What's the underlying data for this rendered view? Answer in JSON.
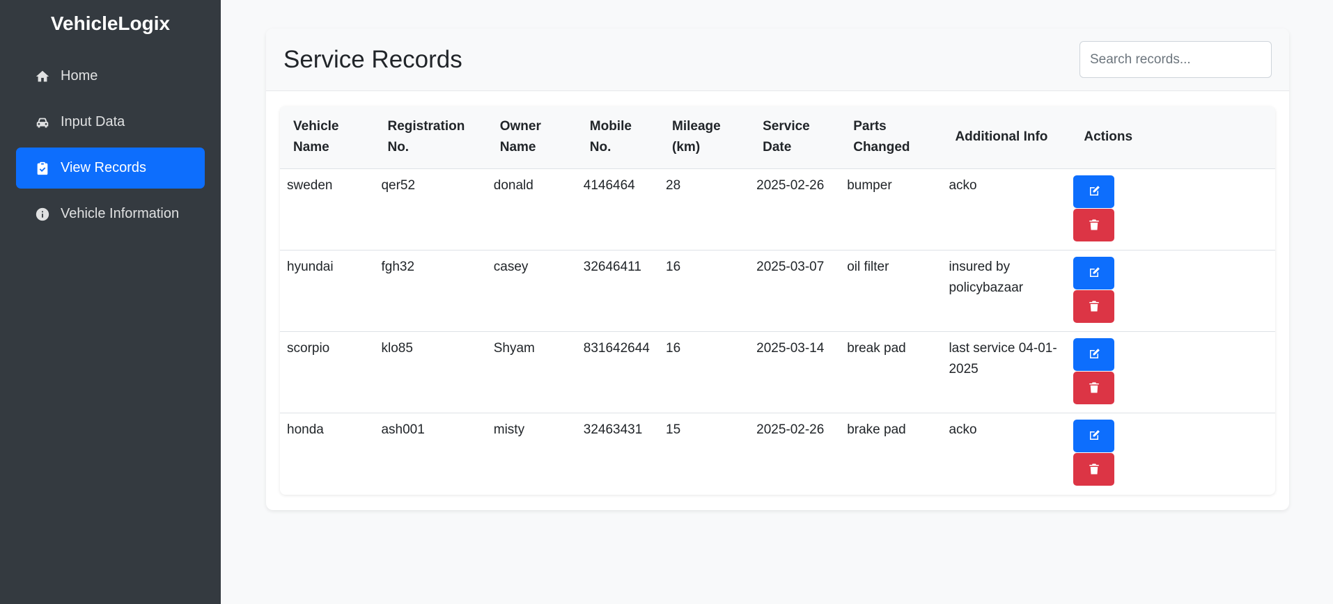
{
  "app": {
    "brand": "VehicleLogix"
  },
  "sidebar": {
    "items": [
      {
        "label": "Home",
        "icon": "home-icon"
      },
      {
        "label": "Input Data",
        "icon": "car-icon"
      },
      {
        "label": "View Records",
        "icon": "clipboard-icon",
        "active": true
      },
      {
        "label": "Vehicle Information",
        "icon": "info-icon"
      }
    ]
  },
  "main": {
    "title": "Service Records",
    "search": {
      "placeholder": "Search records...",
      "value": ""
    },
    "table": {
      "headers": [
        "Vehicle Name",
        "Registration No.",
        "Owner Name",
        "Mobile No.",
        "Mileage (km)",
        "Service Date",
        "Parts Changed",
        "Additional Info",
        "Actions"
      ],
      "rows": [
        {
          "vehicle": "sweden",
          "reg": "qer52",
          "owner": "donald",
          "mobile": "4146464",
          "mileage": "28",
          "date": "2025-02-26",
          "parts": "bumper",
          "info": "acko"
        },
        {
          "vehicle": "hyundai",
          "reg": "fgh32",
          "owner": "casey",
          "mobile": "32646411",
          "mileage": "16",
          "date": "2025-03-07",
          "parts": "oil filter",
          "info": "insured by policybazaar"
        },
        {
          "vehicle": "scorpio",
          "reg": "klo85",
          "owner": "Shyam",
          "mobile": "831642644",
          "mileage": "16",
          "date": "2025-03-14",
          "parts": "break pad",
          "info": "last service 04-01-2025"
        },
        {
          "vehicle": "honda",
          "reg": "ash001",
          "owner": "misty",
          "mobile": "32463431",
          "mileage": "15",
          "date": "2025-02-26",
          "parts": "brake pad",
          "info": "acko"
        }
      ]
    }
  },
  "colors": {
    "sidebar_bg": "#343a40",
    "primary": "#0d6efd",
    "danger": "#dc3545"
  }
}
